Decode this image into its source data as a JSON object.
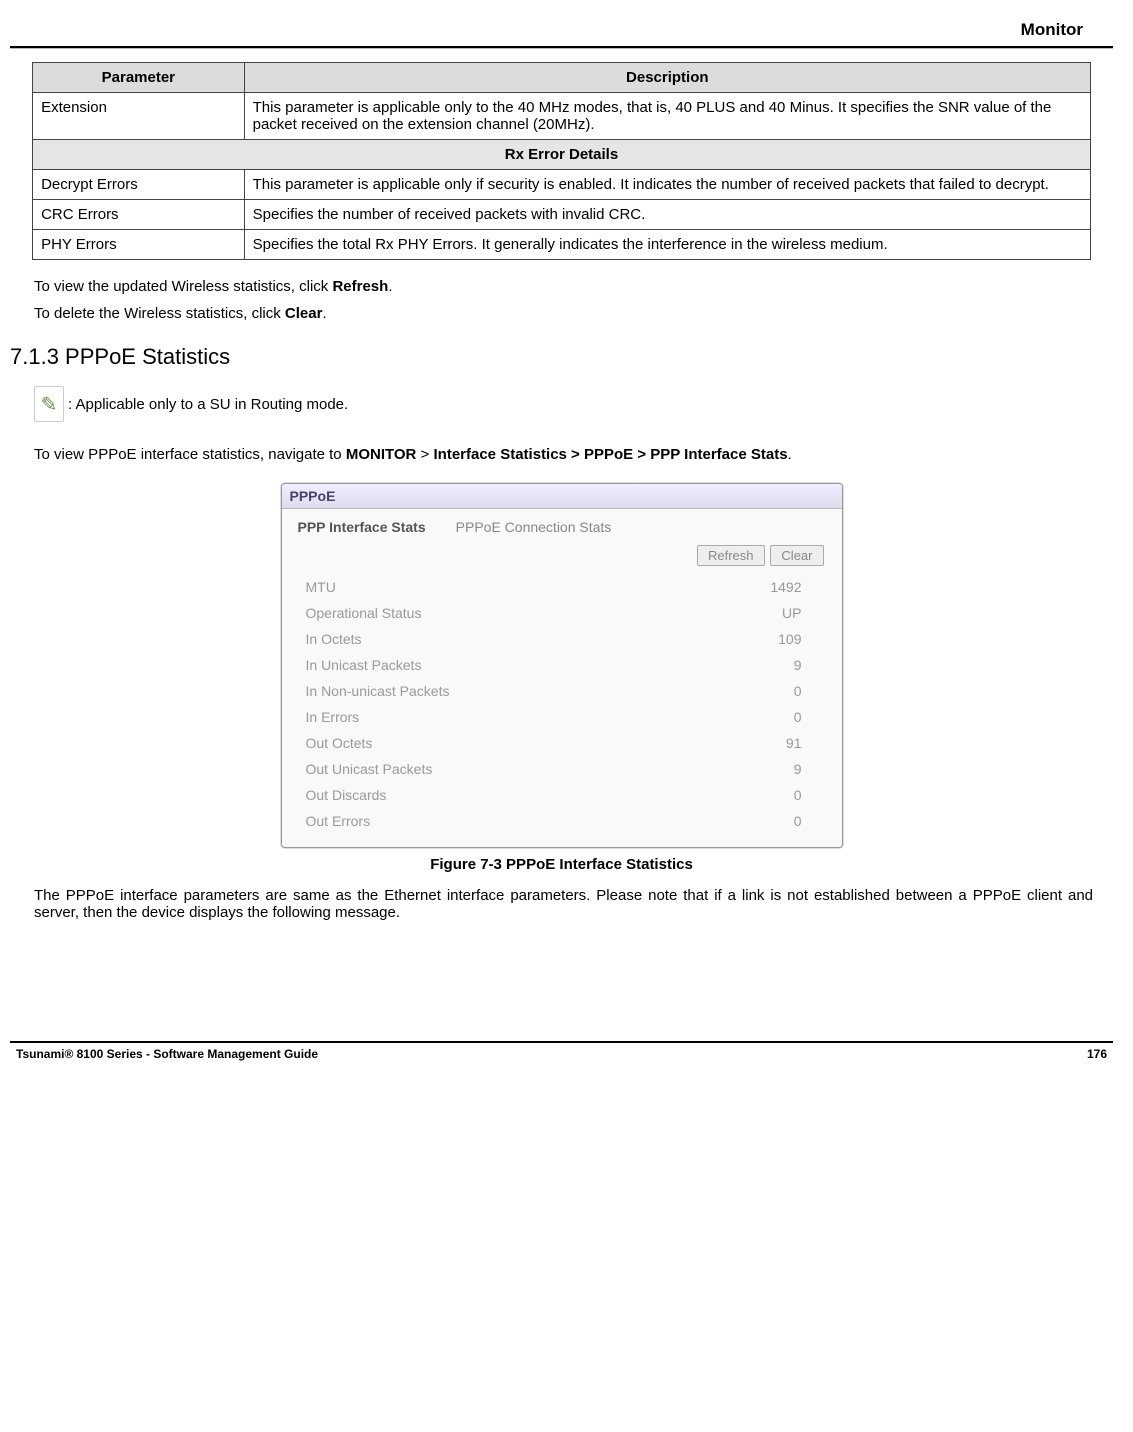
{
  "header": {
    "section": "Monitor"
  },
  "table": {
    "head_param": "Parameter",
    "head_desc": "Description",
    "rows": [
      {
        "p": "Extension",
        "d": "This parameter is applicable only to the 40 MHz modes, that is, 40 PLUS and 40 Minus. It specifies the SNR value of the packet received on the extension channel (20MHz)."
      }
    ],
    "subhead": "Rx Error Details",
    "rows2": [
      {
        "p": "Decrypt Errors",
        "d": "This parameter is applicable only if security is enabled. It indicates the number of received packets that failed to decrypt."
      },
      {
        "p": "CRC Errors",
        "d": "Specifies the number of received packets with invalid CRC."
      },
      {
        "p": "PHY Errors",
        "d": "Specifies the total Rx PHY Errors. It generally indicates the interference in the wireless medium."
      }
    ]
  },
  "para": {
    "refresh_pre": "To view the updated Wireless statistics, click ",
    "refresh_b": "Refresh",
    "clear_pre": "To delete the Wireless statistics, click ",
    "clear_b": "Clear",
    "heading": "7.1.3 PPPoE Statistics",
    "note": ": Applicable only to a SU in Routing mode.",
    "nav_pre": "To view PPPoE interface statistics, navigate to ",
    "nav_b1": "MONITOR",
    "nav_gt": " > ",
    "nav_b2": "Interface Statistics > PPPoE > PPP Interface Stats",
    "fig_caption": "Figure 7-3 PPPoE Interface Statistics",
    "after_fig": "The PPPoE interface parameters are same as the Ethernet interface parameters. Please note that if a link is not established between a PPPoE client and server, then the device displays the following message."
  },
  "ss": {
    "title": "PPPoE",
    "tab_active": "PPP Interface Stats",
    "tab_inactive": "PPPoE Connection Stats",
    "btn_refresh": "Refresh",
    "btn_clear": "Clear",
    "rows": [
      {
        "l": "MTU",
        "v": "1492"
      },
      {
        "l": "Operational Status",
        "v": "UP"
      },
      {
        "l": "In Octets",
        "v": "109"
      },
      {
        "l": "In Unicast Packets",
        "v": "9"
      },
      {
        "l": "In Non-unicast Packets",
        "v": "0"
      },
      {
        "l": "In Errors",
        "v": "0"
      },
      {
        "l": "Out Octets",
        "v": "91"
      },
      {
        "l": "Out Unicast Packets",
        "v": "9"
      },
      {
        "l": "Out Discards",
        "v": "0"
      },
      {
        "l": "Out Errors",
        "v": "0"
      }
    ]
  },
  "footer": {
    "left": "Tsunami® 8100 Series - Software Management Guide",
    "right": "176"
  }
}
